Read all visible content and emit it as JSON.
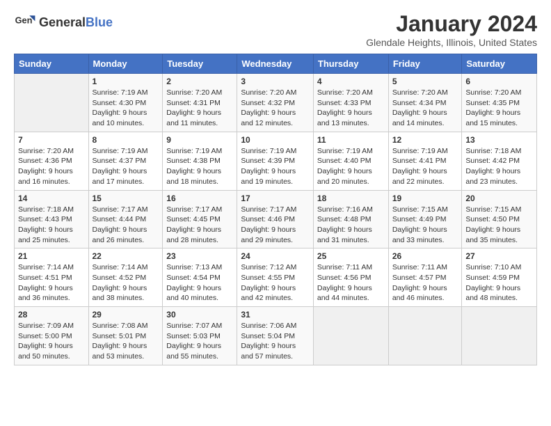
{
  "header": {
    "logo_general": "General",
    "logo_blue": "Blue",
    "title": "January 2024",
    "subtitle": "Glendale Heights, Illinois, United States"
  },
  "days_of_week": [
    "Sunday",
    "Monday",
    "Tuesday",
    "Wednesday",
    "Thursday",
    "Friday",
    "Saturday"
  ],
  "weeks": [
    [
      {
        "day": "",
        "info": ""
      },
      {
        "day": "1",
        "info": "Sunrise: 7:19 AM\nSunset: 4:30 PM\nDaylight: 9 hours\nand 10 minutes."
      },
      {
        "day": "2",
        "info": "Sunrise: 7:20 AM\nSunset: 4:31 PM\nDaylight: 9 hours\nand 11 minutes."
      },
      {
        "day": "3",
        "info": "Sunrise: 7:20 AM\nSunset: 4:32 PM\nDaylight: 9 hours\nand 12 minutes."
      },
      {
        "day": "4",
        "info": "Sunrise: 7:20 AM\nSunset: 4:33 PM\nDaylight: 9 hours\nand 13 minutes."
      },
      {
        "day": "5",
        "info": "Sunrise: 7:20 AM\nSunset: 4:34 PM\nDaylight: 9 hours\nand 14 minutes."
      },
      {
        "day": "6",
        "info": "Sunrise: 7:20 AM\nSunset: 4:35 PM\nDaylight: 9 hours\nand 15 minutes."
      }
    ],
    [
      {
        "day": "7",
        "info": "Sunrise: 7:20 AM\nSunset: 4:36 PM\nDaylight: 9 hours\nand 16 minutes."
      },
      {
        "day": "8",
        "info": "Sunrise: 7:19 AM\nSunset: 4:37 PM\nDaylight: 9 hours\nand 17 minutes."
      },
      {
        "day": "9",
        "info": "Sunrise: 7:19 AM\nSunset: 4:38 PM\nDaylight: 9 hours\nand 18 minutes."
      },
      {
        "day": "10",
        "info": "Sunrise: 7:19 AM\nSunset: 4:39 PM\nDaylight: 9 hours\nand 19 minutes."
      },
      {
        "day": "11",
        "info": "Sunrise: 7:19 AM\nSunset: 4:40 PM\nDaylight: 9 hours\nand 20 minutes."
      },
      {
        "day": "12",
        "info": "Sunrise: 7:19 AM\nSunset: 4:41 PM\nDaylight: 9 hours\nand 22 minutes."
      },
      {
        "day": "13",
        "info": "Sunrise: 7:18 AM\nSunset: 4:42 PM\nDaylight: 9 hours\nand 23 minutes."
      }
    ],
    [
      {
        "day": "14",
        "info": "Sunrise: 7:18 AM\nSunset: 4:43 PM\nDaylight: 9 hours\nand 25 minutes."
      },
      {
        "day": "15",
        "info": "Sunrise: 7:17 AM\nSunset: 4:44 PM\nDaylight: 9 hours\nand 26 minutes."
      },
      {
        "day": "16",
        "info": "Sunrise: 7:17 AM\nSunset: 4:45 PM\nDaylight: 9 hours\nand 28 minutes."
      },
      {
        "day": "17",
        "info": "Sunrise: 7:17 AM\nSunset: 4:46 PM\nDaylight: 9 hours\nand 29 minutes."
      },
      {
        "day": "18",
        "info": "Sunrise: 7:16 AM\nSunset: 4:48 PM\nDaylight: 9 hours\nand 31 minutes."
      },
      {
        "day": "19",
        "info": "Sunrise: 7:15 AM\nSunset: 4:49 PM\nDaylight: 9 hours\nand 33 minutes."
      },
      {
        "day": "20",
        "info": "Sunrise: 7:15 AM\nSunset: 4:50 PM\nDaylight: 9 hours\nand 35 minutes."
      }
    ],
    [
      {
        "day": "21",
        "info": "Sunrise: 7:14 AM\nSunset: 4:51 PM\nDaylight: 9 hours\nand 36 minutes."
      },
      {
        "day": "22",
        "info": "Sunrise: 7:14 AM\nSunset: 4:52 PM\nDaylight: 9 hours\nand 38 minutes."
      },
      {
        "day": "23",
        "info": "Sunrise: 7:13 AM\nSunset: 4:54 PM\nDaylight: 9 hours\nand 40 minutes."
      },
      {
        "day": "24",
        "info": "Sunrise: 7:12 AM\nSunset: 4:55 PM\nDaylight: 9 hours\nand 42 minutes."
      },
      {
        "day": "25",
        "info": "Sunrise: 7:11 AM\nSunset: 4:56 PM\nDaylight: 9 hours\nand 44 minutes."
      },
      {
        "day": "26",
        "info": "Sunrise: 7:11 AM\nSunset: 4:57 PM\nDaylight: 9 hours\nand 46 minutes."
      },
      {
        "day": "27",
        "info": "Sunrise: 7:10 AM\nSunset: 4:59 PM\nDaylight: 9 hours\nand 48 minutes."
      }
    ],
    [
      {
        "day": "28",
        "info": "Sunrise: 7:09 AM\nSunset: 5:00 PM\nDaylight: 9 hours\nand 50 minutes."
      },
      {
        "day": "29",
        "info": "Sunrise: 7:08 AM\nSunset: 5:01 PM\nDaylight: 9 hours\nand 53 minutes."
      },
      {
        "day": "30",
        "info": "Sunrise: 7:07 AM\nSunset: 5:03 PM\nDaylight: 9 hours\nand 55 minutes."
      },
      {
        "day": "31",
        "info": "Sunrise: 7:06 AM\nSunset: 5:04 PM\nDaylight: 9 hours\nand 57 minutes."
      },
      {
        "day": "",
        "info": ""
      },
      {
        "day": "",
        "info": ""
      },
      {
        "day": "",
        "info": ""
      }
    ]
  ]
}
